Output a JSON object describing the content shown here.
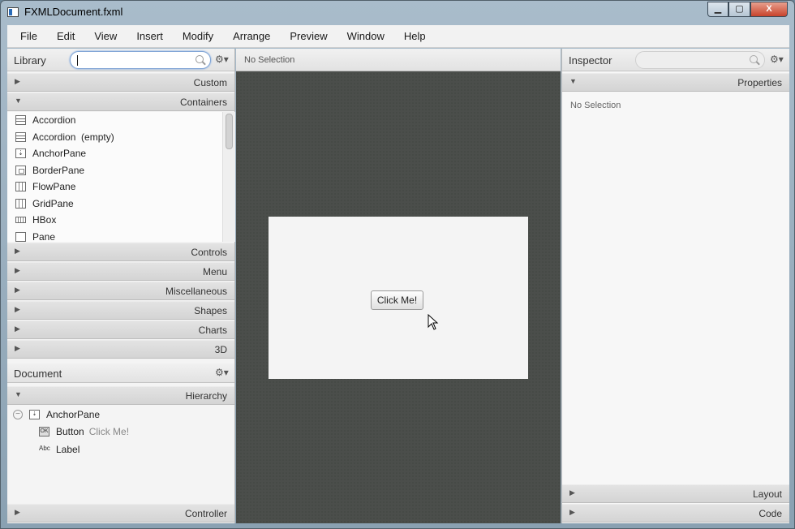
{
  "window": {
    "title": "FXMLDocument.fxml",
    "controls": {
      "minimize": "▁",
      "maximize": "▢",
      "close": "X"
    }
  },
  "menubar": [
    "File",
    "Edit",
    "View",
    "Insert",
    "Modify",
    "Arrange",
    "Preview",
    "Window",
    "Help"
  ],
  "library": {
    "title": "Library",
    "search_value": "",
    "gear": "⚙▾",
    "sections": [
      {
        "label": "Custom",
        "expanded": false
      },
      {
        "label": "Containers",
        "expanded": true
      }
    ],
    "containers": [
      {
        "label": "Accordion",
        "icon": "accordion-icon"
      },
      {
        "label": "Accordion  (empty)",
        "icon": "accordion-icon"
      },
      {
        "label": "AnchorPane",
        "icon": "anchorpane-icon"
      },
      {
        "label": "BorderPane",
        "icon": "borderpane-icon"
      },
      {
        "label": "FlowPane",
        "icon": "flowpane-icon"
      },
      {
        "label": "GridPane",
        "icon": "gridpane-icon"
      },
      {
        "label": "HBox",
        "icon": "hbox-icon"
      },
      {
        "label": "Pane",
        "icon": "pane-icon"
      }
    ],
    "collapsed_sections": [
      "Controls",
      "Menu",
      "Miscellaneous",
      "Shapes",
      "Charts",
      "3D"
    ]
  },
  "document": {
    "title": "Document",
    "gear": "⚙▾",
    "hierarchy_label": "Hierarchy",
    "tree": [
      {
        "label": "AnchorPane",
        "icon": "anchorpane-icon",
        "toggle": "−"
      },
      {
        "label": "Button",
        "sub": "Click Me!",
        "icon": "button-icon",
        "icon_text": "OK"
      },
      {
        "label": "Label",
        "icon": "label-icon",
        "icon_text": "Abc"
      }
    ],
    "controller_label": "Controller"
  },
  "stage": {
    "selection": "No Selection",
    "button_text": "Click Me!"
  },
  "inspector": {
    "title": "Inspector",
    "gear": "⚙▾",
    "properties_label": "Properties",
    "no_selection": "No Selection",
    "layout_label": "Layout",
    "code_label": "Code"
  },
  "arrows": {
    "collapsed": "▶",
    "expanded": "▼"
  }
}
